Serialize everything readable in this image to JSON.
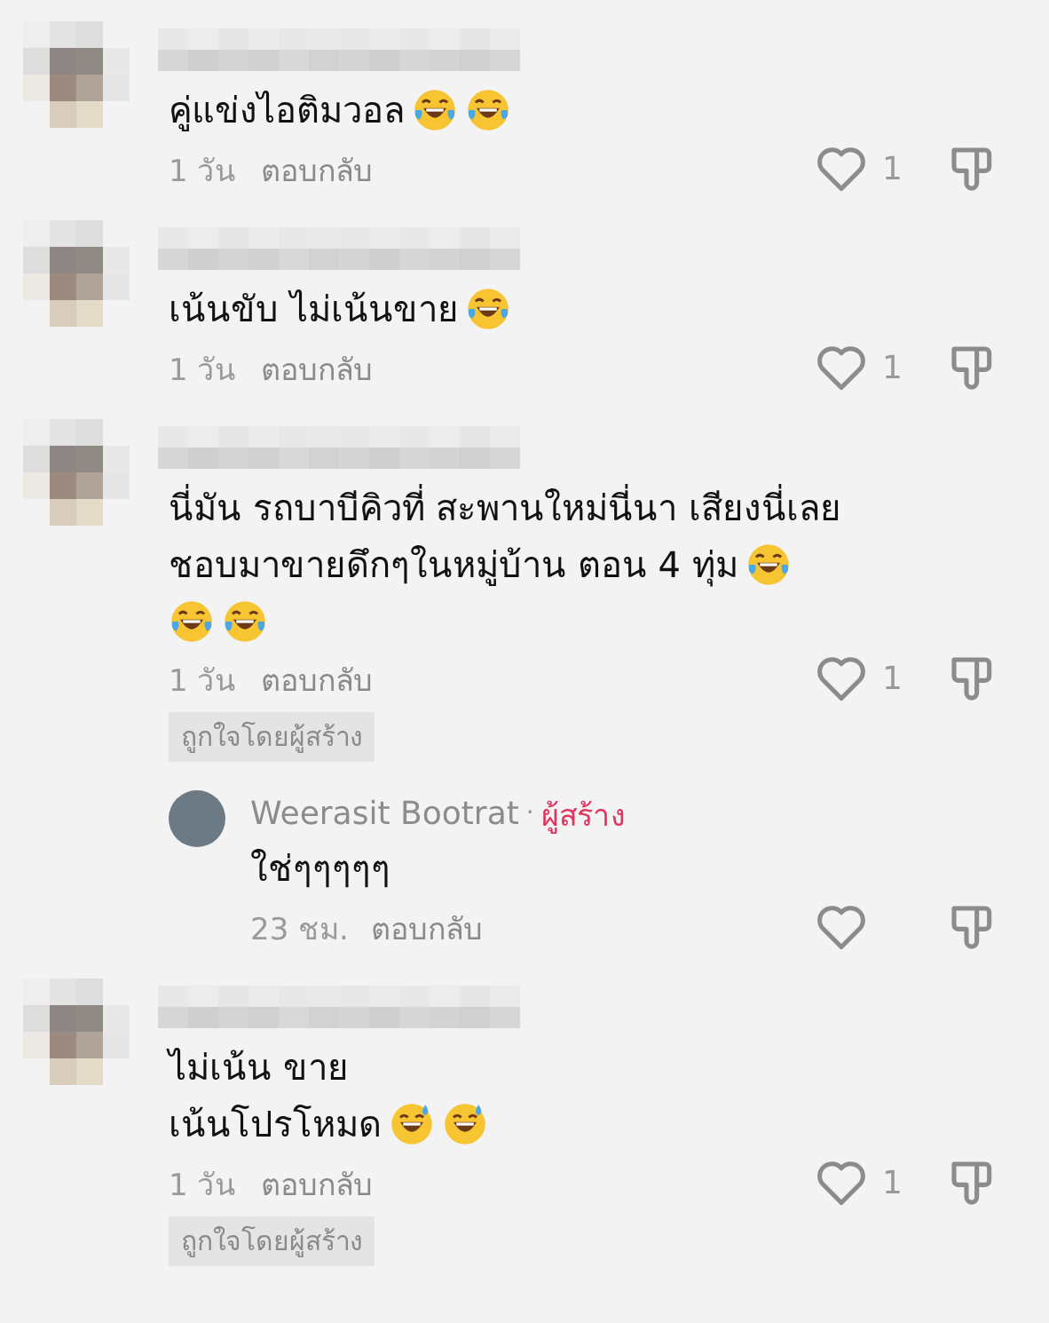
{
  "comments": [
    {
      "lines": [
        {
          "text": "คู่แข่งไอติมวอล",
          "emoji": [
            {
              "kind": "joy"
            },
            {
              "kind": "joy"
            }
          ]
        }
      ],
      "time": "1 วัน",
      "reply": "ตอบกลับ",
      "likes": "1"
    },
    {
      "lines": [
        {
          "text": "เน้นขับ ไม่เน้นขาย",
          "emoji": [
            {
              "kind": "joy"
            }
          ]
        }
      ],
      "time": "1 วัน",
      "reply": "ตอบกลับ",
      "likes": "1"
    },
    {
      "lines": [
        {
          "text": "นี่มัน รถบาบีคิวที่ สะพานใหม่นี่นา เสียงนี่เลย"
        },
        {
          "text": "ชอบมาขายดึกๆในหมู่บ้าน ตอน 4 ทุ่ม",
          "emoji": [
            {
              "kind": "joy"
            }
          ]
        },
        {
          "emoji": [
            {
              "kind": "joy"
            },
            {
              "kind": "joy"
            }
          ]
        }
      ],
      "time": "1 วัน",
      "reply": "ตอบกลับ",
      "likes": "1",
      "badge": "ถูกใจโดยผู้สร้าง",
      "replies": [
        {
          "author": "Weerasit Bootrat",
          "separator": "·",
          "role": "ผู้สร้าง",
          "text": "ใช่ๆๆๆๆๆ",
          "time": "23 ชม.",
          "reply": "ตอบกลับ"
        }
      ]
    },
    {
      "lines": [
        {
          "text": "ไม่เน้น ขาย"
        },
        {
          "text": "เน้นโปรโหมด",
          "emoji": [
            {
              "kind": "sweat_smile"
            },
            {
              "kind": "sweat_smile"
            }
          ]
        }
      ],
      "time": "1 วัน",
      "reply": "ตอบกลับ",
      "likes": "1",
      "badge": "ถูกใจโดยผู้สร้าง"
    }
  ]
}
